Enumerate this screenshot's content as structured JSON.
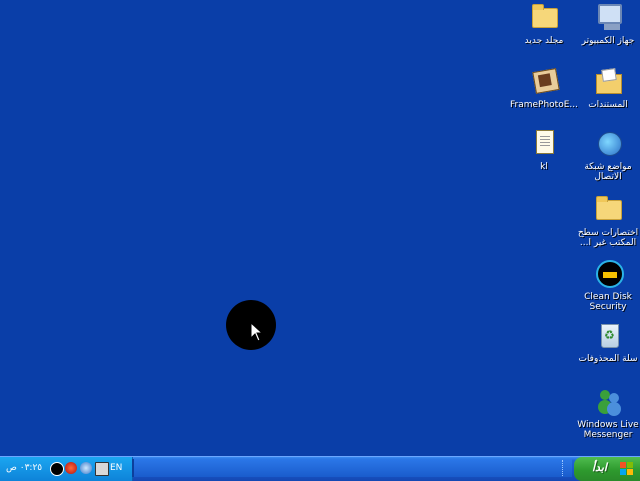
{
  "desktop": {
    "icons": [
      {
        "id": "my-computer",
        "label": "جهاز الكمبيوتر",
        "icon": "computer-icon",
        "rtl": true
      },
      {
        "id": "new-folder",
        "label": "مجلد جديد",
        "icon": "folder-icon",
        "rtl": true
      },
      {
        "id": "my-documents",
        "label": "المستندات",
        "icon": "documents-folder-icon",
        "rtl": true
      },
      {
        "id": "framephoto",
        "label": "FramePhotoE...",
        "icon": "framephoto-icon",
        "rtl": false
      },
      {
        "id": "network-places",
        "label": "مواضع شبكة الاتصال",
        "icon": "network-icon",
        "rtl": true
      },
      {
        "id": "kl-file",
        "label": "kl",
        "icon": "notepad-file-icon",
        "rtl": false
      },
      {
        "id": "unused-shortcuts",
        "label": "اختصارات سطح المكتب غير ا...",
        "icon": "folder-icon",
        "rtl": true
      },
      {
        "id": "clean-disk",
        "label": "Clean Disk Security",
        "icon": "clean-disk-icon",
        "rtl": false
      },
      {
        "id": "recycle-bin",
        "label": "سلة المحذوفات",
        "icon": "recycle-bin-icon",
        "rtl": true
      },
      {
        "id": "messenger",
        "label": "Windows Live Messenger",
        "icon": "messenger-icon",
        "rtl": false
      }
    ]
  },
  "taskbar": {
    "clock": "٠٣:٢٥ ص",
    "language": "EN",
    "start_label": "ابدأ",
    "tray_icons": [
      "volume-icon",
      "media-icon",
      "network-status-icon",
      "safely-remove-icon",
      "notepad-tray-icon"
    ]
  },
  "colors": {
    "desktop_bg": "#0a3ea8",
    "taskbar": "#1f64d6",
    "start_green": "#2e9a2e"
  }
}
